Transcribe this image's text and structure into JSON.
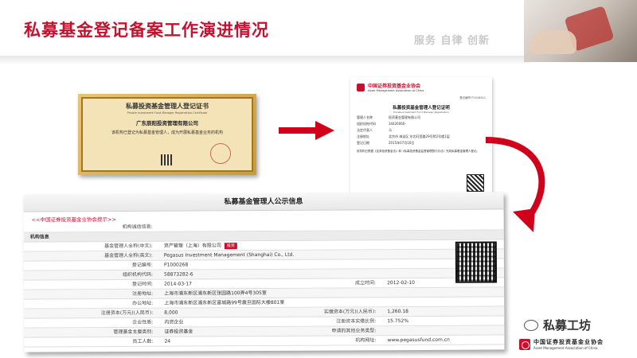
{
  "header": {
    "title": "私募基金登记备案工作演进情况",
    "motto": "服务 自律 创新"
  },
  "certificate": {
    "title": "私募投资基金管理人登记证书",
    "title_en": "Private Investment Fund Manager Registration Certificate",
    "company": "广东辰阳投资管理有限公司",
    "body": "该机构已登记为私募基金管理人，成为开展私募基金业务的机构"
  },
  "proof": {
    "org": "中国证券投资基金业协会",
    "org_en": "Asset Management Association of China",
    "number": "登记编号 P1018411",
    "title": "私募投资基金管理人登记证明",
    "title_en": "Private Investment Fund Manager Registration",
    "rows": [
      {
        "k": "管理人名称",
        "v": "投资基金管理有限公司"
      },
      {
        "k": "组织机构代码",
        "v": "34426066-"
      },
      {
        "k": "法定代表人",
        "v": "马"
      },
      {
        "k": "注册地址",
        "v": "北京市 海淀区 东北旺西路29号院2号楼1层"
      },
      {
        "k": "登记日期",
        "v": "2015年07月16日"
      }
    ],
    "note": "依机构已根据《证券投资基金法》和《私募投资基金监督管理暂行办法》完成私募基金管理人登记。"
  },
  "disclosure": {
    "title": "私募基金管理人公示信息",
    "link": "<<中国证券投资基金业协会提示>>",
    "rows": [
      {
        "k": "机构诚信信息:",
        "v": ""
      },
      {
        "section": "机构信息"
      },
      {
        "k": "基金管理人全称(中文):",
        "v": "资产管理（上海）有限公司",
        "badge": "投资"
      },
      {
        "k": "基金管理人全称(英文):",
        "v": "Pegasus Investment Management (Shanghai) Co., Ltd."
      },
      {
        "k": "登记编号:",
        "v": "P1000268"
      },
      {
        "k": "组织机构代码:",
        "v": "58873282-6"
      },
      {
        "k": "登记时间:",
        "v": "2014-03-17",
        "k2": "成立时间:",
        "v2": "2012-02-10"
      },
      {
        "k": "注册地址:",
        "v": "上海市浦东新区浦东新区张园路100弄4号305室"
      },
      {
        "k": "办公地址:",
        "v": "上海市浦东新区浦东新区富城路99号震旦国际大楼801室"
      },
      {
        "k": "注册资本(万元)(人民币):",
        "v": "8,000",
        "k2": "实缴资本(万元)(人民币):",
        "v2": "1,260.18"
      },
      {
        "k": "企业性质:",
        "v": "内资企业",
        "k2": "注册资本实缴比例:",
        "v2": "15.752%"
      },
      {
        "k": "管理基金主要类别:",
        "v": "证券投资基金",
        "k2": "申请的其他业务类型:",
        "v2": ""
      },
      {
        "k": "员工人数:",
        "v": "24",
        "k2": "机构网址:",
        "v2": "www.pegasusfund.com.cn"
      }
    ]
  },
  "branding": {
    "wechat_name": "私募工坊",
    "footer_org": "中国证券投资基金业协会",
    "footer_org_en": "Asset Management Association of China"
  },
  "colors": {
    "accent": "#c8102e",
    "motto": "#c9c9c9"
  }
}
